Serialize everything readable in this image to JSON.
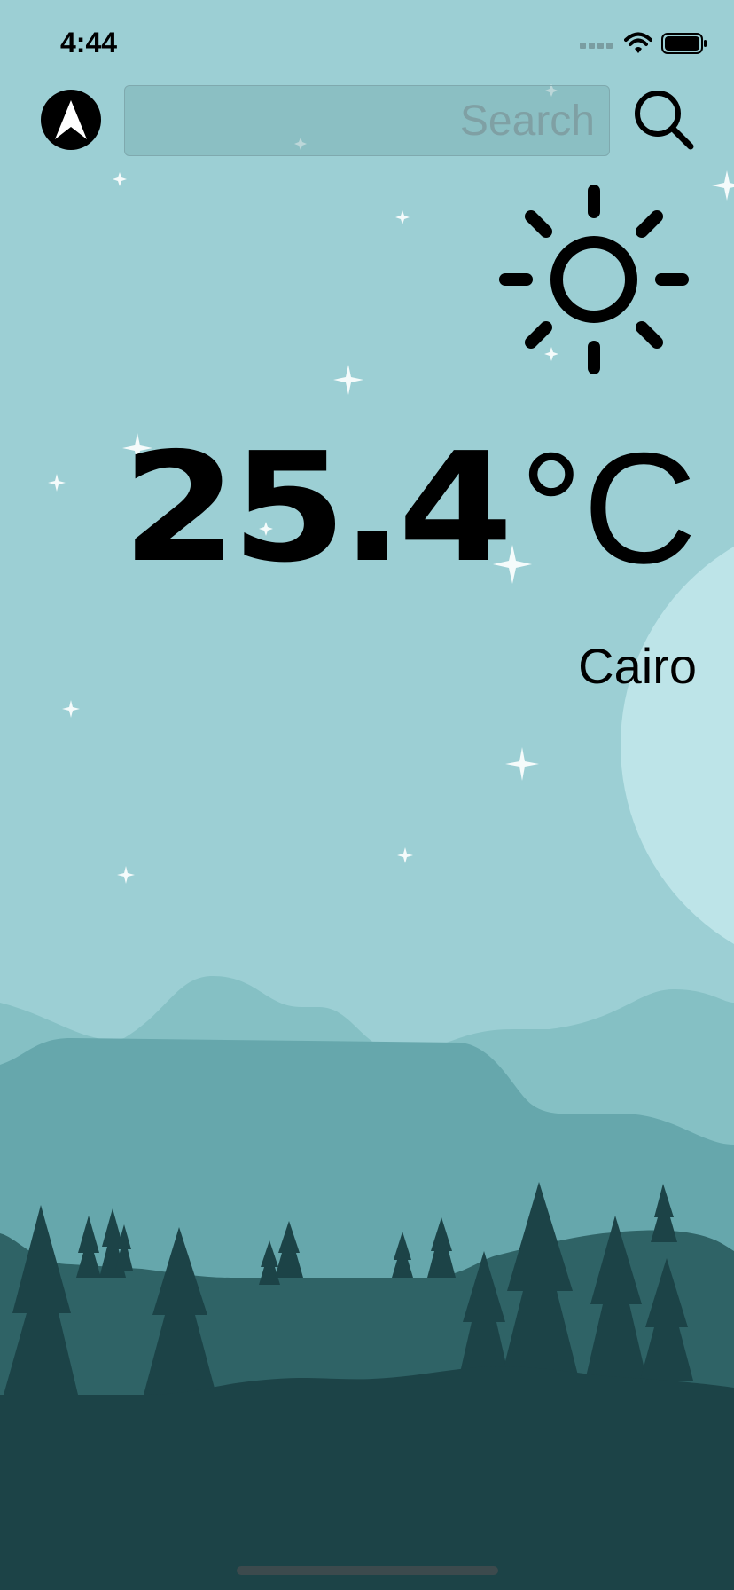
{
  "status_bar": {
    "time": "4:44",
    "signal_icon": "cellular-signal-icon",
    "wifi_icon": "wifi-icon",
    "battery_icon": "battery-icon"
  },
  "toolbar": {
    "location_icon": "navigation-arrow-icon",
    "search_placeholder": "Search",
    "search_value": "",
    "search_icon": "magnifying-glass-icon"
  },
  "weather": {
    "condition_icon": "sun-icon",
    "temperature": "25.4",
    "unit": "°C",
    "city": "Cairo"
  },
  "colors": {
    "sky": "#9ccfd4",
    "moon": "#bde4e8",
    "far_hills": "#85c0c4",
    "mid_hills": "#66a7ac",
    "near_hills": "#2f6366",
    "trees": "#1c4347",
    "ground": "#1c4347"
  }
}
